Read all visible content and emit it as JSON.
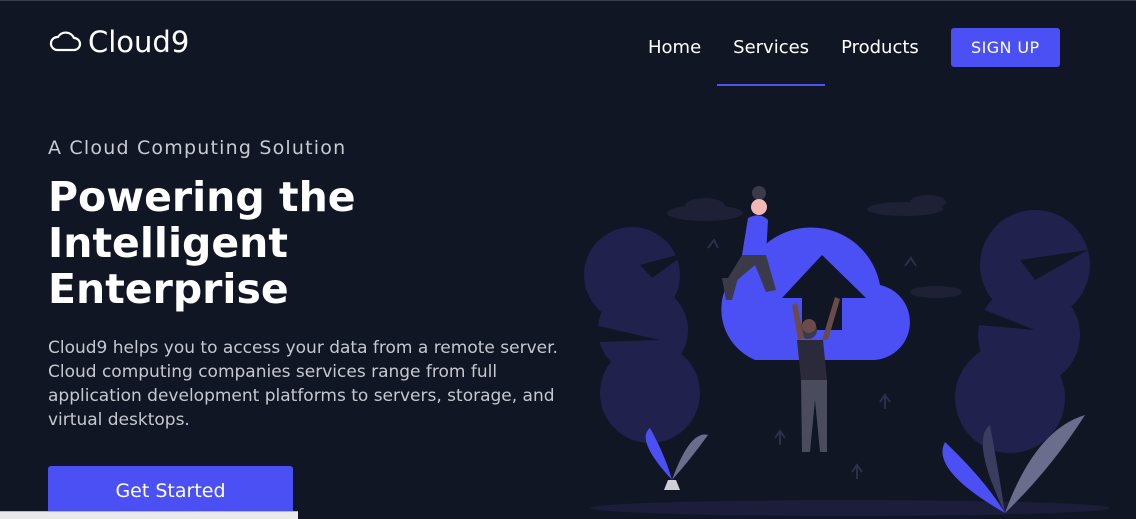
{
  "brand": {
    "name": "Cloud9",
    "icon": "cloud-icon"
  },
  "nav": {
    "items": [
      {
        "label": "Home",
        "active": false
      },
      {
        "label": "Services",
        "active": true
      },
      {
        "label": "Products",
        "active": false
      }
    ],
    "signup_label": "SIGN UP"
  },
  "hero": {
    "eyebrow": "A Cloud Computing Solution",
    "headline": "Powering the Intelligent Enterprise",
    "description": "Cloud9 helps you to access your data from a remote server. Cloud computing companies services range from full application development platforms to servers, storage, and virtual desktops.",
    "cta_label": "Get Started"
  },
  "colors": {
    "background": "#111624",
    "accent": "#4a50f4",
    "muted_text": "#c6c8cf",
    "tree": "#20214d"
  }
}
